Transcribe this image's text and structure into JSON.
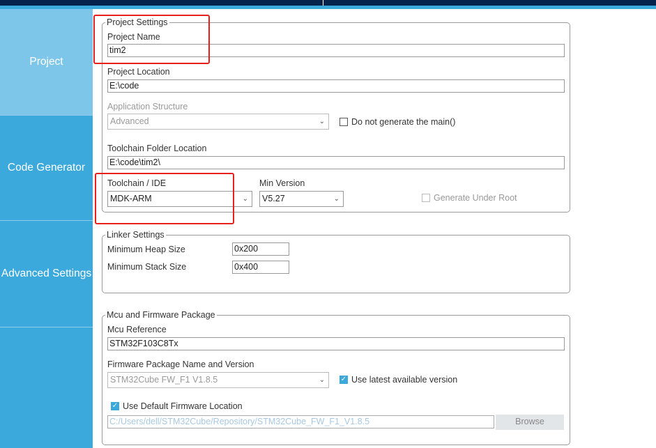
{
  "sidebar": {
    "items": [
      {
        "label": "Project",
        "active": true
      },
      {
        "label": "Code Generator"
      },
      {
        "label": "Advanced Settings"
      }
    ]
  },
  "project_settings": {
    "legend": "Project Settings",
    "project_name_label": "Project Name",
    "project_name": "tim2",
    "project_location_label": "Project Location",
    "project_location": "E:\\code",
    "app_structure_label": "Application Structure",
    "app_structure": "Advanced",
    "no_main_label": "Do not generate the main()",
    "no_main_checked": false,
    "toolchain_folder_label": "Toolchain Folder Location",
    "toolchain_folder": "E:\\code\\tim2\\",
    "toolchain_label": "Toolchain / IDE",
    "toolchain": "MDK-ARM",
    "min_version_label": "Min Version",
    "min_version": "V5.27",
    "gen_under_root_label": "Generate Under Root",
    "gen_under_root_checked": false
  },
  "linker_settings": {
    "legend": "Linker Settings",
    "heap_label": "Minimum Heap Size",
    "heap": "0x200",
    "stack_label": "Minimum Stack Size",
    "stack": "0x400"
  },
  "mcu": {
    "legend": "Mcu and Firmware Package",
    "ref_label": "Mcu Reference",
    "ref": "STM32F103C8Tx",
    "fw_label": "Firmware Package Name and Version",
    "fw": "STM32Cube FW_F1 V1.8.5",
    "use_latest_label": "Use latest available version",
    "use_latest_checked": true,
    "use_default_loc_label": "Use Default Firmware Location",
    "use_default_loc_checked": true,
    "fw_location": "C:/Users/dell/STM32Cube/Repository/STM32Cube_FW_F1_V1.8.5",
    "browse_label": "Browse"
  },
  "colors": {
    "sidebar": "#3ba9dc",
    "sidebar_active": "#7dc6e9",
    "topbar": "#04224b",
    "highlight": "#e8201c"
  }
}
